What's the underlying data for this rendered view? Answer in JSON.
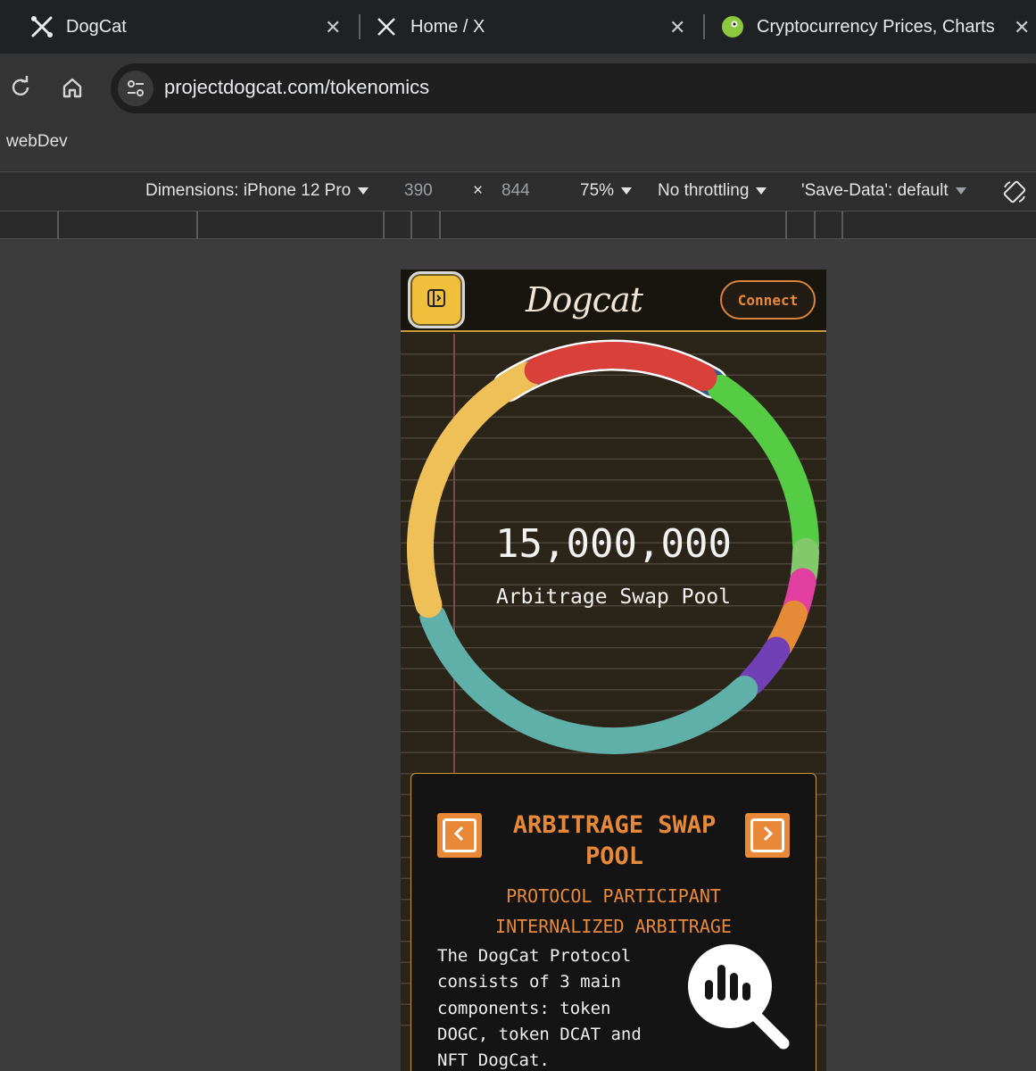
{
  "browser": {
    "tabs": [
      {
        "title": "DogCat",
        "icon": "crossed-tools-icon"
      },
      {
        "title": "Home / X",
        "icon": "x-logo-icon"
      },
      {
        "title": "Cryptocurrency Prices, Charts",
        "icon": "gecko-icon"
      }
    ],
    "url": "projectdogcat.com/tokenomics",
    "bookmarks": [
      "webDev"
    ]
  },
  "devtools": {
    "device": "Dimensions: iPhone 12 Pro",
    "width": "390",
    "times": "×",
    "height": "844",
    "zoom": "75%",
    "throttling": "No throttling",
    "save_data": "'Save-Data': default"
  },
  "app": {
    "logo_text": "Dogcat",
    "connect_label": "Connect",
    "center_value": "15,000,000",
    "center_label": "Arbitrage Swap Pool",
    "card": {
      "title": "ARBITRAGE SWAP POOL",
      "subtitle_line1": "PROTOCOL PARTICIPANT",
      "subtitle_line2": "INTERNALIZED ARBITRAGE",
      "body": "The DogCat Protocol consists of 3 main components: token DOGC, token DCAT and NFT DogCat."
    },
    "donut_segments": [
      {
        "color": "#2f5a95",
        "selected": true
      },
      {
        "color": "#55cc44"
      },
      {
        "color": "#82c96c"
      },
      {
        "color": "#e23fa0"
      },
      {
        "color": "#e58a36"
      },
      {
        "color": "#7140b6"
      },
      {
        "color": "#5eb0a8"
      },
      {
        "color": "#efbf58"
      },
      {
        "color": "#d9403a"
      }
    ]
  }
}
